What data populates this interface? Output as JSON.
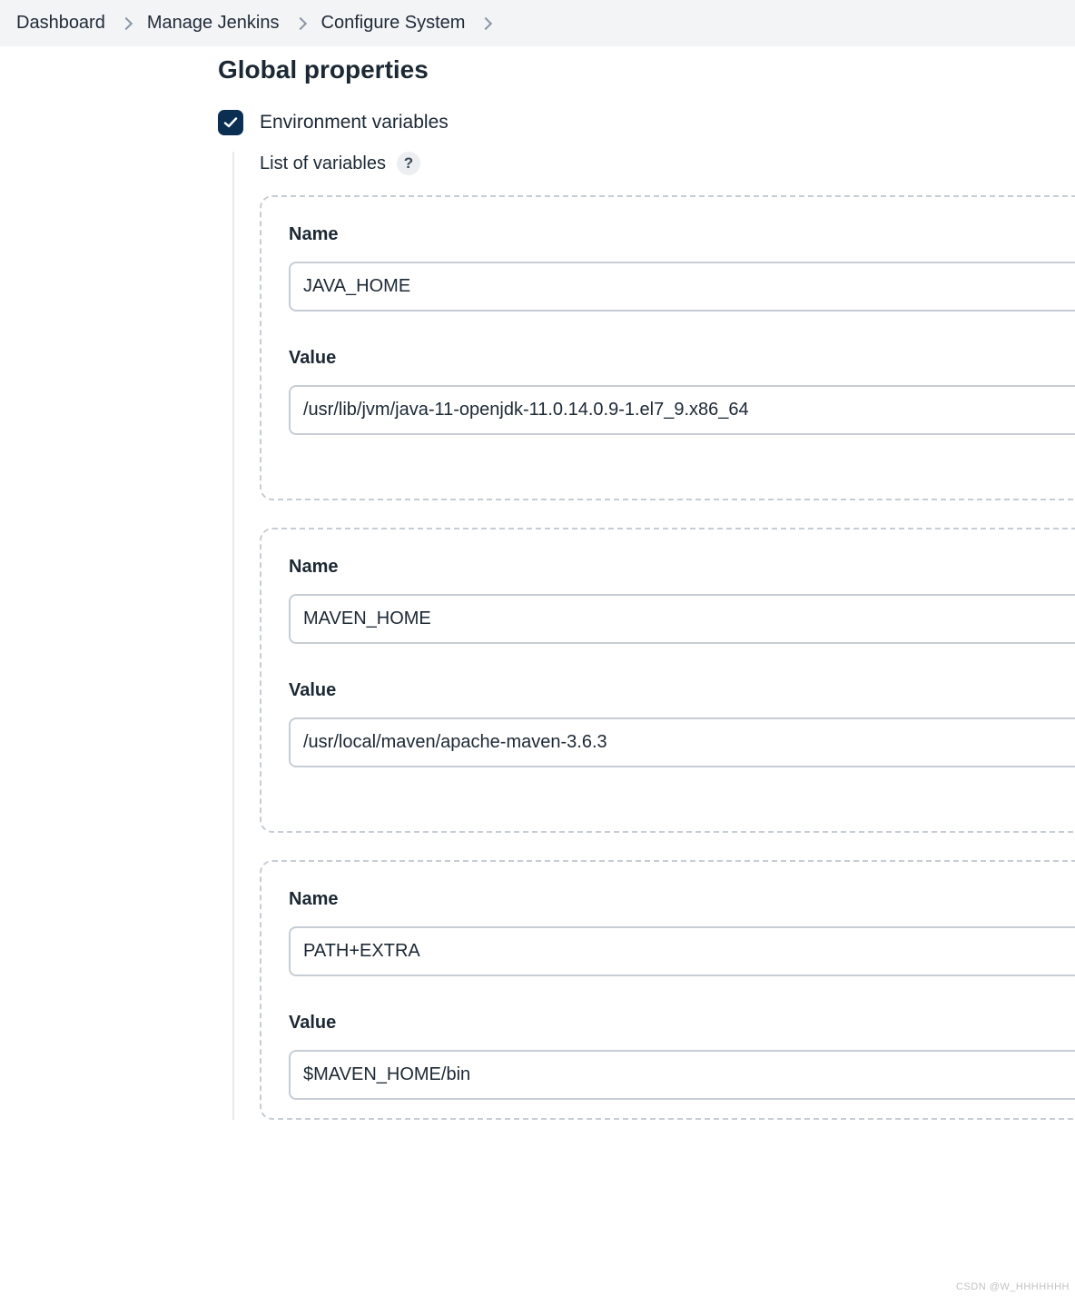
{
  "breadcrumbs": [
    "Dashboard",
    "Manage Jenkins",
    "Configure System"
  ],
  "section": {
    "title": "Global properties",
    "envvars_checkbox_label": "Environment variables",
    "list_label": "List of variables",
    "help_glyph": "?"
  },
  "labels": {
    "name": "Name",
    "value": "Value"
  },
  "variables": [
    {
      "name": "JAVA_HOME",
      "value": "/usr/lib/jvm/java-11-openjdk-11.0.14.0.9-1.el7_9.x86_64"
    },
    {
      "name": "MAVEN_HOME",
      "value": "/usr/local/maven/apache-maven-3.6.3"
    },
    {
      "name": "PATH+EXTRA",
      "value": "$MAVEN_HOME/bin"
    }
  ],
  "watermark": "CSDN @W_HHHHHHH"
}
